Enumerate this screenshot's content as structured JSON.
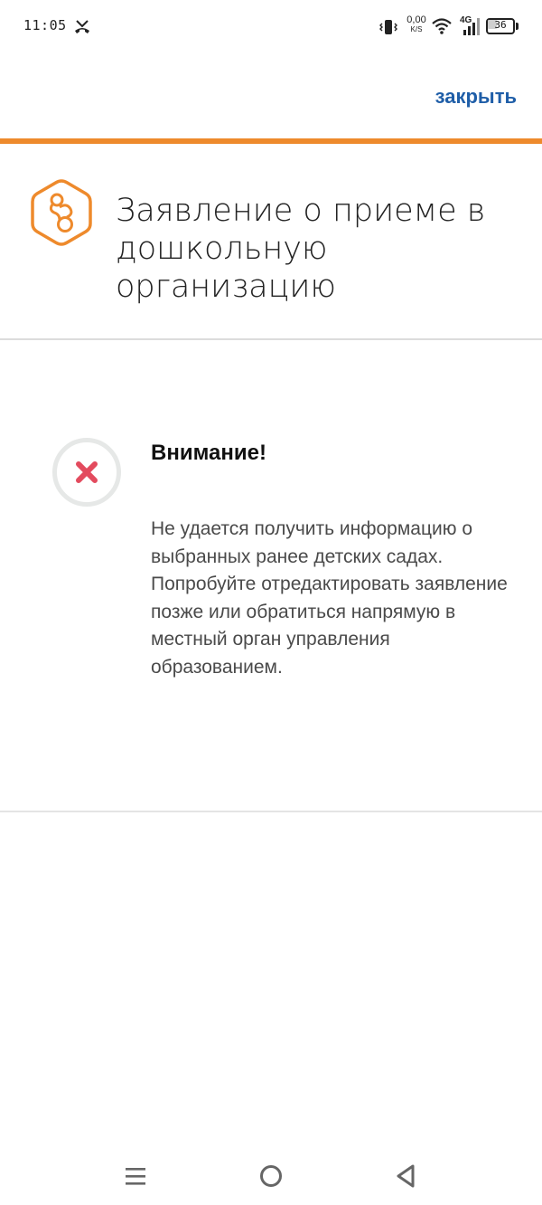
{
  "status_bar": {
    "time": "11:05",
    "net_speed_value": "0,00",
    "net_speed_unit": "K/S",
    "network_type": "4G",
    "battery_level": "36",
    "battery_fraction": 0.36
  },
  "header": {
    "close_label": "закрыть",
    "accent_color": "#ee8a2c",
    "link_color": "#1f5ea8"
  },
  "service": {
    "icon": "pacifier-icon",
    "title": "Заявление о приеме в дошкольную организацию"
  },
  "alert": {
    "icon": "error-x-icon",
    "title": "Внимание!",
    "message": "Не удается получить информацию о выбранных ранее детских садах. Попробуйте отредактировать заявление позже или обратиться напрямую в местный орган управления образованием.",
    "error_color": "#e34b5e"
  },
  "nav": {
    "icons": [
      "menu-icon",
      "home-icon",
      "back-icon"
    ]
  }
}
